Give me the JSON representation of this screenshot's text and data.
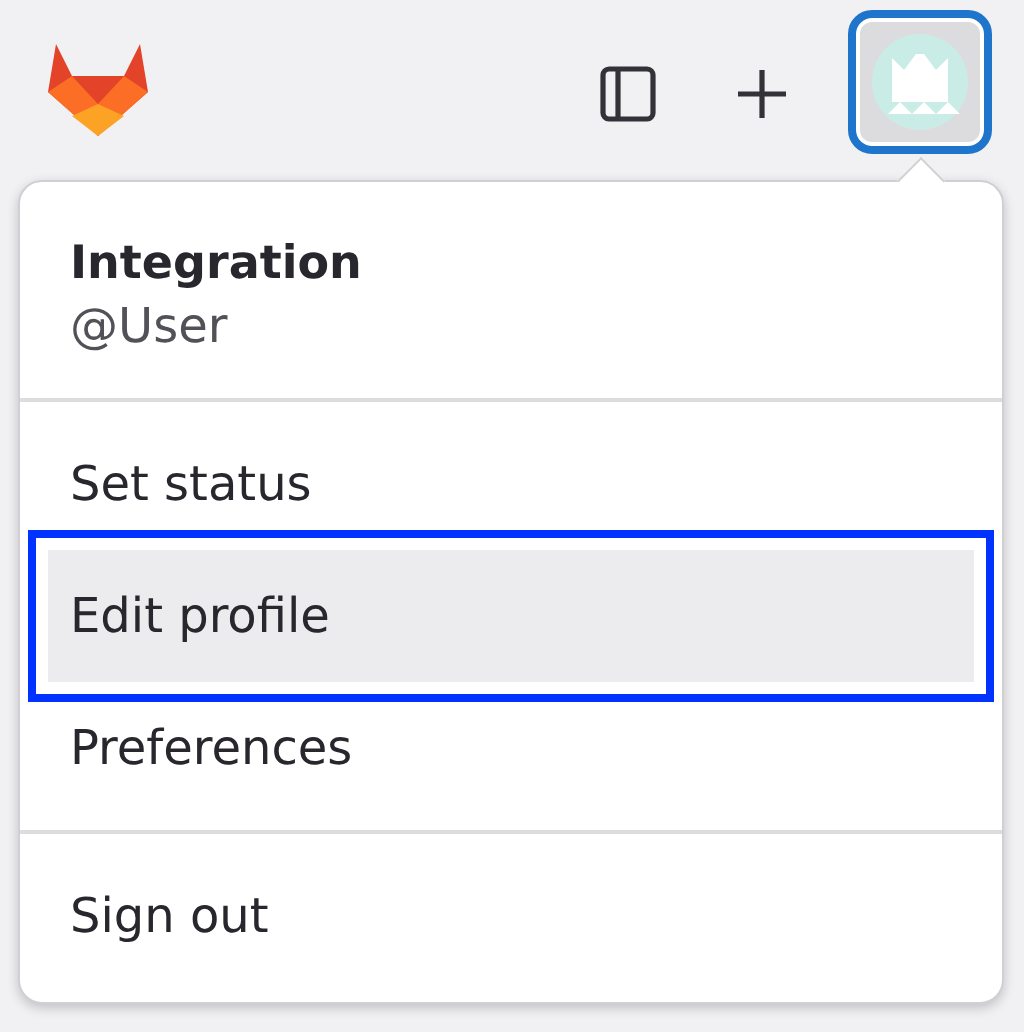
{
  "header": {
    "buttons": [
      {
        "kind": "sidebar"
      },
      {
        "kind": "plus"
      }
    ]
  },
  "user_menu": {
    "name": "Integration",
    "username": "@User",
    "groups": [
      [
        {
          "label": "Set status",
          "selected": false
        },
        {
          "label": "Edit profile",
          "selected": true
        },
        {
          "label": "Preferences",
          "selected": false
        }
      ],
      [
        {
          "label": "Sign out",
          "selected": false
        }
      ]
    ]
  }
}
